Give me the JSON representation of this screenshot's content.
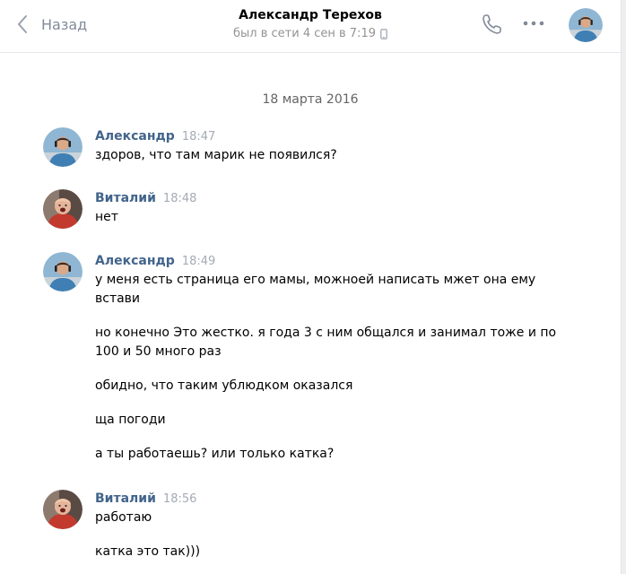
{
  "header": {
    "back_label": "Назад",
    "title": "Александр Терехов",
    "status": "был в сети 4 сен в 7:19"
  },
  "date_separator": "18 марта 2016",
  "messages": [
    {
      "author": "Александр",
      "time": "18:47",
      "lines": [
        "здоров, что там марик не появился?"
      ]
    },
    {
      "author": "Виталий",
      "time": "18:48",
      "lines": [
        "нет"
      ]
    },
    {
      "author": "Александр",
      "time": "18:49",
      "lines": [
        "у меня есть страница его мамы, можноей написать мжет она ему встави",
        "но конечно Это жестко. я года 3 с ним общался и занимал тоже и по 100 и 50 много раз",
        "обидно, что таким ублюдком оказался",
        "ща погоди",
        "а ты работаешь? или только катка?"
      ]
    },
    {
      "author": "Виталий",
      "time": "18:56",
      "lines": [
        "работаю",
        "катка это так)))"
      ]
    }
  ],
  "colors": {
    "author": "#42648b",
    "time": "#a5aab4",
    "muted": "#828a99",
    "background": "#edeef0"
  },
  "icons": [
    "chevron-left-icon",
    "mobile-device-icon",
    "phone-icon",
    "more-dots-icon"
  ]
}
